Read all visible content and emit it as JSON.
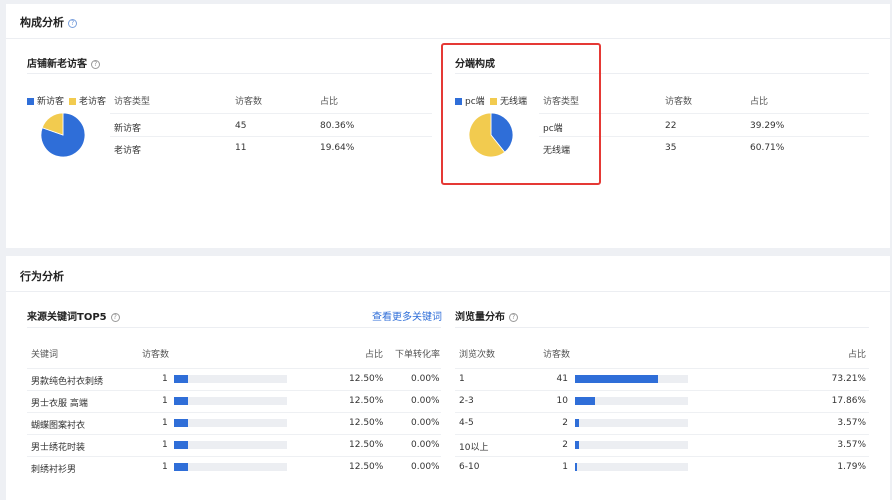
{
  "composition": {
    "title": "构成分析",
    "new_old": {
      "title": "店铺新老访客",
      "legend": [
        {
          "label": "新访客",
          "color": "#2f6ed8"
        },
        {
          "label": "老访客",
          "color": "#f2cb4f"
        }
      ],
      "headers": [
        "访客类型",
        "访客数",
        "占比"
      ],
      "rows": [
        {
          "type": "新访客",
          "count": "45",
          "pct": "80.36%"
        },
        {
          "type": "老访客",
          "count": "11",
          "pct": "19.64%"
        }
      ],
      "pie": [
        80.36,
        19.64
      ]
    },
    "device": {
      "title": "分端构成",
      "legend": [
        {
          "label": "pc端",
          "color": "#2f6ed8"
        },
        {
          "label": "无线端",
          "color": "#f2cb4f"
        }
      ],
      "headers": [
        "访客类型",
        "访客数",
        "占比"
      ],
      "rows": [
        {
          "type": "pc端",
          "count": "22",
          "pct": "39.29%"
        },
        {
          "type": "无线端",
          "count": "35",
          "pct": "60.71%"
        }
      ],
      "pie": [
        39.29,
        60.71
      ]
    }
  },
  "behavior": {
    "title": "行为分析",
    "keywords": {
      "title": "来源关键词TOP5",
      "more_link": "查看更多关键词",
      "headers": [
        "关键词",
        "访客数",
        "占比",
        "下单转化率"
      ],
      "rows": [
        {
          "keyword": "男款纯色衬衣刺绣",
          "count": "1",
          "share": 0.125,
          "pct": "12.50%",
          "conv": "0.00%"
        },
        {
          "keyword": "男士衣服 高端",
          "count": "1",
          "share": 0.125,
          "pct": "12.50%",
          "conv": "0.00%"
        },
        {
          "keyword": "蝴蝶图案衬衣",
          "count": "1",
          "share": 0.125,
          "pct": "12.50%",
          "conv": "0.00%"
        },
        {
          "keyword": "男士绣花时装",
          "count": "1",
          "share": 0.125,
          "pct": "12.50%",
          "conv": "0.00%"
        },
        {
          "keyword": "刺绣衬衫男",
          "count": "1",
          "share": 0.125,
          "pct": "12.50%",
          "conv": "0.00%"
        }
      ]
    },
    "pageviews": {
      "title": "浏览量分布",
      "headers": [
        "浏览次数",
        "访客数",
        "占比"
      ],
      "rows": [
        {
          "range": "1",
          "count": "41",
          "share": 0.7321,
          "pct": "73.21%"
        },
        {
          "range": "2-3",
          "count": "10",
          "share": 0.1786,
          "pct": "17.86%"
        },
        {
          "range": "4-5",
          "count": "2",
          "share": 0.0357,
          "pct": "3.57%"
        },
        {
          "range": "10以上",
          "count": "2",
          "share": 0.0357,
          "pct": "3.57%"
        },
        {
          "range": "6-10",
          "count": "1",
          "share": 0.0179,
          "pct": "1.79%"
        }
      ]
    }
  }
}
